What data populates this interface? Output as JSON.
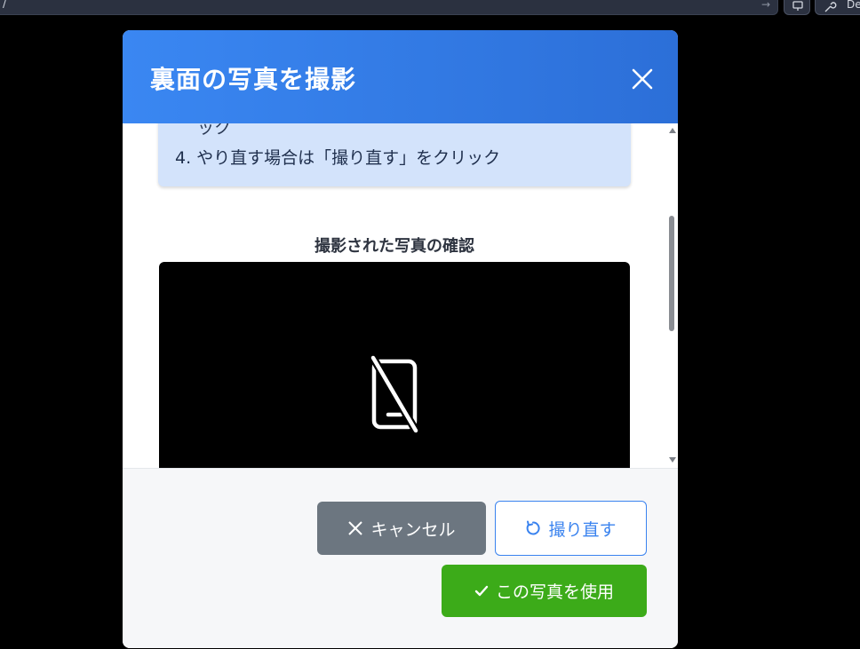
{
  "browser": {
    "url_text": "/",
    "dev_label": "De"
  },
  "modal": {
    "title": "裏面の写真を撮影",
    "instructions": {
      "continued_text": "ック",
      "step4": "4. やり直す場合は「撮り直す」をクリック"
    },
    "preview_label": "撮影された写真の確認",
    "buttons": {
      "cancel": "キャンセル",
      "retake": "撮り直す",
      "use": "この写真を使用"
    }
  },
  "colors": {
    "header_start": "#3a87f2",
    "header_end": "#2c6fd8",
    "instructions_bg": "#d3e3fb",
    "cancel_bg": "#6c7680",
    "retake_border": "#3a83ef",
    "use_bg": "#3cab19"
  },
  "icons": {
    "close": "close-icon",
    "no_phone": "phone-off-icon",
    "cancel": "x-icon",
    "retake": "rotate-ccw-icon",
    "use": "check-icon"
  }
}
